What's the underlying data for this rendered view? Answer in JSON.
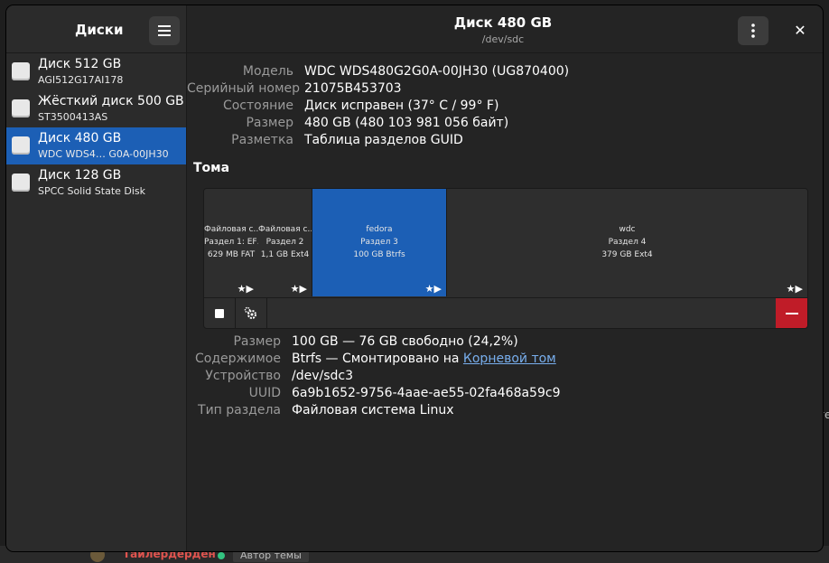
{
  "sidebar": {
    "title": "Диски",
    "disks": [
      {
        "name": "Диск 512 GB",
        "sub": "AGI512G17AI178"
      },
      {
        "name": "Жёсткий диск 500 GB",
        "sub": "ST3500413AS"
      },
      {
        "name": "Диск 480 GB",
        "sub": "WDC WDS4…  G0A-00JH30"
      },
      {
        "name": "Диск 128 GB",
        "sub": "SPCC Solid State Disk"
      }
    ]
  },
  "header": {
    "title": "Диск 480 GB",
    "subtitle": "/dev/sdc"
  },
  "disk_info": {
    "model_label": "Модель",
    "model": "WDC WDS480G2G0A-00JH30 (UG870400)",
    "serial_label": "Серийный номер",
    "serial": "21075B453703",
    "state_label": "Состояние",
    "state": "Диск исправен (37° C / 99° F)",
    "size_label": "Размер",
    "size": "480 GB (480 103 981 056 байт)",
    "layout_label": "Разметка",
    "layout": "Таблица разделов GUID"
  },
  "volumes": {
    "title": "Тома",
    "partitions": [
      {
        "line1": "Файловая с… EF…",
        "line2": "Раздел 1: EF…",
        "line3": "629 MB FAT"
      },
      {
        "line1": "Файловая с…",
        "line2": "Раздел 2",
        "line3": "1,1 GB Ext4"
      },
      {
        "line1": "fedora",
        "line2": "Раздел 3",
        "line3": "100 GB Btrfs"
      },
      {
        "line1": "wdc",
        "line2": "Раздел 4",
        "line3": "379 GB Ext4"
      }
    ],
    "stars": "★▶"
  },
  "partition_info": {
    "size_label": "Размер",
    "size": "100 GB — 76 GB свободно (24,2%)",
    "content_label": "Содержимое",
    "content_prefix": "Btrfs — Смонтировано на ",
    "content_link": "Корневой том",
    "device_label": "Устройство",
    "device": "/dev/sdc3",
    "uuid_label": "UUID",
    "uuid": "6a9b1652-9756-4aae-ae55-02fa468a59c9",
    "type_label": "Тип раздела",
    "type": "Файловая система Linux"
  },
  "background": {
    "user": "Тайлердерден",
    "badge": "Автор темы",
    "right_text": "те"
  },
  "colors": {
    "accent": "#1c5fb5",
    "destructive": "#c01c28",
    "link": "#78aeed"
  }
}
